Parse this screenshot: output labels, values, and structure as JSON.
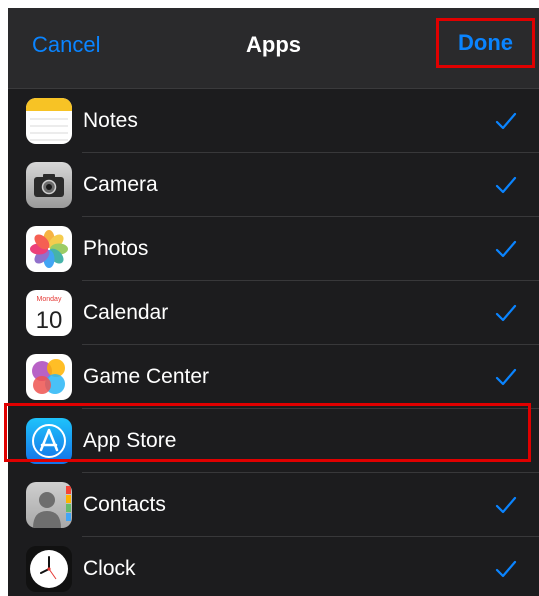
{
  "navbar": {
    "cancel_label": "Cancel",
    "title": "Apps",
    "done_label": "Done"
  },
  "apps": [
    {
      "name": "Notes",
      "icon": "notes-icon",
      "checked": true
    },
    {
      "name": "Camera",
      "icon": "camera-icon",
      "checked": true
    },
    {
      "name": "Photos",
      "icon": "photos-icon",
      "checked": true
    },
    {
      "name": "Calendar",
      "icon": "calendar-icon",
      "checked": true,
      "icon_text": {
        "month": "Monday",
        "day": "10"
      }
    },
    {
      "name": "Game Center",
      "icon": "game-center-icon",
      "checked": true
    },
    {
      "name": "App Store",
      "icon": "app-store-icon",
      "checked": false
    },
    {
      "name": "Contacts",
      "icon": "contacts-icon",
      "checked": true
    },
    {
      "name": "Clock",
      "icon": "clock-icon",
      "checked": true
    }
  ],
  "colors": {
    "accent": "#0a84ff",
    "highlight": "#e00000",
    "background": "#1c1c1e"
  }
}
